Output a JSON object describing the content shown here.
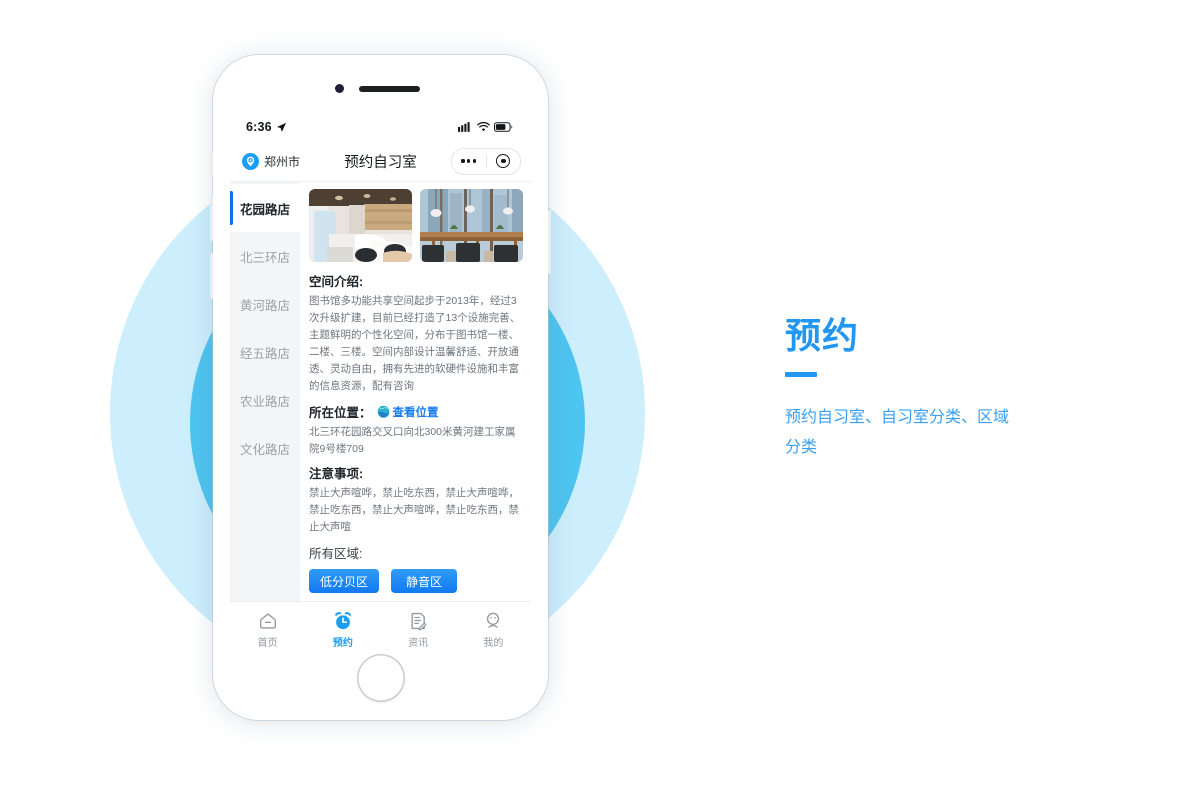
{
  "background": {
    "outer_circle_color": "#cdeefc",
    "inner_circle_color": "#4ec4f0",
    "page_color": "#ffffff"
  },
  "phone": {
    "camera_icon": "camera-dot",
    "speaker_icon": "earpiece-speaker",
    "home_button_icon": "home-button"
  },
  "status_bar": {
    "time": "6:36",
    "location_arrow_icon": "location-arrow-icon",
    "signal_icon": "cellular-signal-icon",
    "wifi_icon": "wifi-icon",
    "battery_icon": "battery-icon"
  },
  "nav_bar": {
    "location_icon": "location-pin-icon",
    "city": "郑州市",
    "title": "预约自习室",
    "capsule": {
      "more_icon": "more-dots-icon",
      "target_icon": "target-circle-icon"
    }
  },
  "sidebar": {
    "items": [
      {
        "label": "花园路店",
        "active": true
      },
      {
        "label": "北三环店",
        "active": false
      },
      {
        "label": "黄河路店",
        "active": false
      },
      {
        "label": "经五路店",
        "active": false
      },
      {
        "label": "农业路店",
        "active": false
      },
      {
        "label": "文化路店",
        "active": false
      }
    ]
  },
  "content": {
    "photos": [
      {
        "name": "study-room-photo",
        "alt": "自习室座位区"
      },
      {
        "name": "window-seating-photo",
        "alt": "靠窗阅读区"
      }
    ],
    "intro": {
      "title": "空间介绍:",
      "body": "图书馆多功能共享空间起步于2013年，经过3次升级扩建，目前已经打造了13个设施完善、主题鲜明的个性化空间，分布于图书馆一楼、二楼、三楼。空间内部设计温馨舒适、开放通透、灵动自由，拥有先进的软硬件设施和丰富的信息资源，配有咨询"
    },
    "location": {
      "title": "所在位置：",
      "link_icon": "globe-location-icon",
      "link_label": "查看位置",
      "address": "北三环花园路交叉口向北300米黄河建工家属院9号楼709"
    },
    "notice": {
      "title": "注意事项:",
      "body": "禁止大声喧哗，禁止吃东西，禁止大声喧哗，禁止吃东西，禁止大声喧哗，禁止吃东西，禁止大声喧"
    },
    "areas": {
      "title": "所有区域:",
      "tags": [
        {
          "label": "低分贝区"
        },
        {
          "label": "静音区"
        }
      ],
      "tag_color": "#1279f2"
    }
  },
  "tab_bar": {
    "items": [
      {
        "label": "首页",
        "icon": "home-icon",
        "active": false
      },
      {
        "label": "预约",
        "icon": "alarm-clock-icon",
        "active": true
      },
      {
        "label": "资讯",
        "icon": "news-document-icon",
        "active": false
      },
      {
        "label": "我的",
        "icon": "user-profile-icon",
        "active": false
      }
    ],
    "active_color": "#1a9ef5",
    "inactive_color": "#9299a1"
  },
  "right_panel": {
    "title": "预约",
    "description": "预约自习室、自习室分类、区域分类",
    "accent_color": "#2196f3"
  }
}
